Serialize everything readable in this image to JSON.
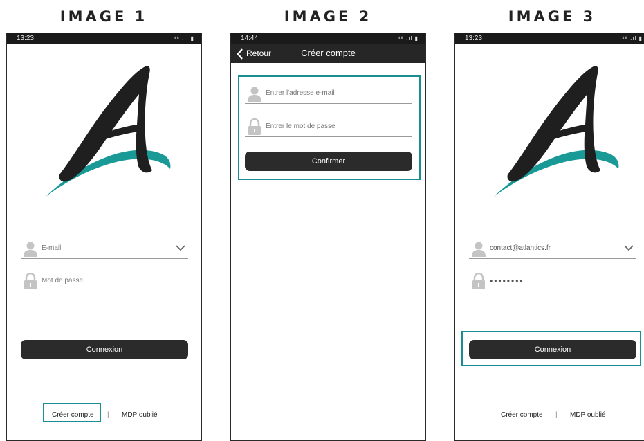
{
  "panels": [
    {
      "title": "IMAGE 1"
    },
    {
      "title": "IMAGE 2"
    },
    {
      "title": "IMAGE 3"
    }
  ],
  "screen1": {
    "time": "13:23",
    "email_placeholder": "E-mail",
    "password_placeholder": "Mot de passe",
    "login_button": "Connexion",
    "create_account": "Créer compte",
    "separator": "|",
    "forgot_password": "MDP oublié"
  },
  "screen2": {
    "time": "14:44",
    "back_label": "Retour",
    "nav_title": "Créer compte",
    "email_placeholder": "Entrer l'adresse e-mail",
    "password_placeholder": "Entrer le mot de passe",
    "confirm_button": "Confirmer"
  },
  "screen3": {
    "time": "13:23",
    "email_value": "contact@atlantics.fr",
    "password_mask": "••••••••",
    "login_button": "Connexion",
    "create_account": "Créer compte",
    "separator": "|",
    "forgot_password": "MDP oublié"
  },
  "colors": {
    "highlight": "#1b8c8f",
    "logo_teal": "#1a9a97",
    "button": "#2b2b2b",
    "status_bar": "#1a1a1a"
  },
  "icons": [
    "user-icon",
    "lock-icon",
    "chevron-down-icon",
    "back-chevron-icon",
    "signal-icon",
    "battery-icon"
  ]
}
